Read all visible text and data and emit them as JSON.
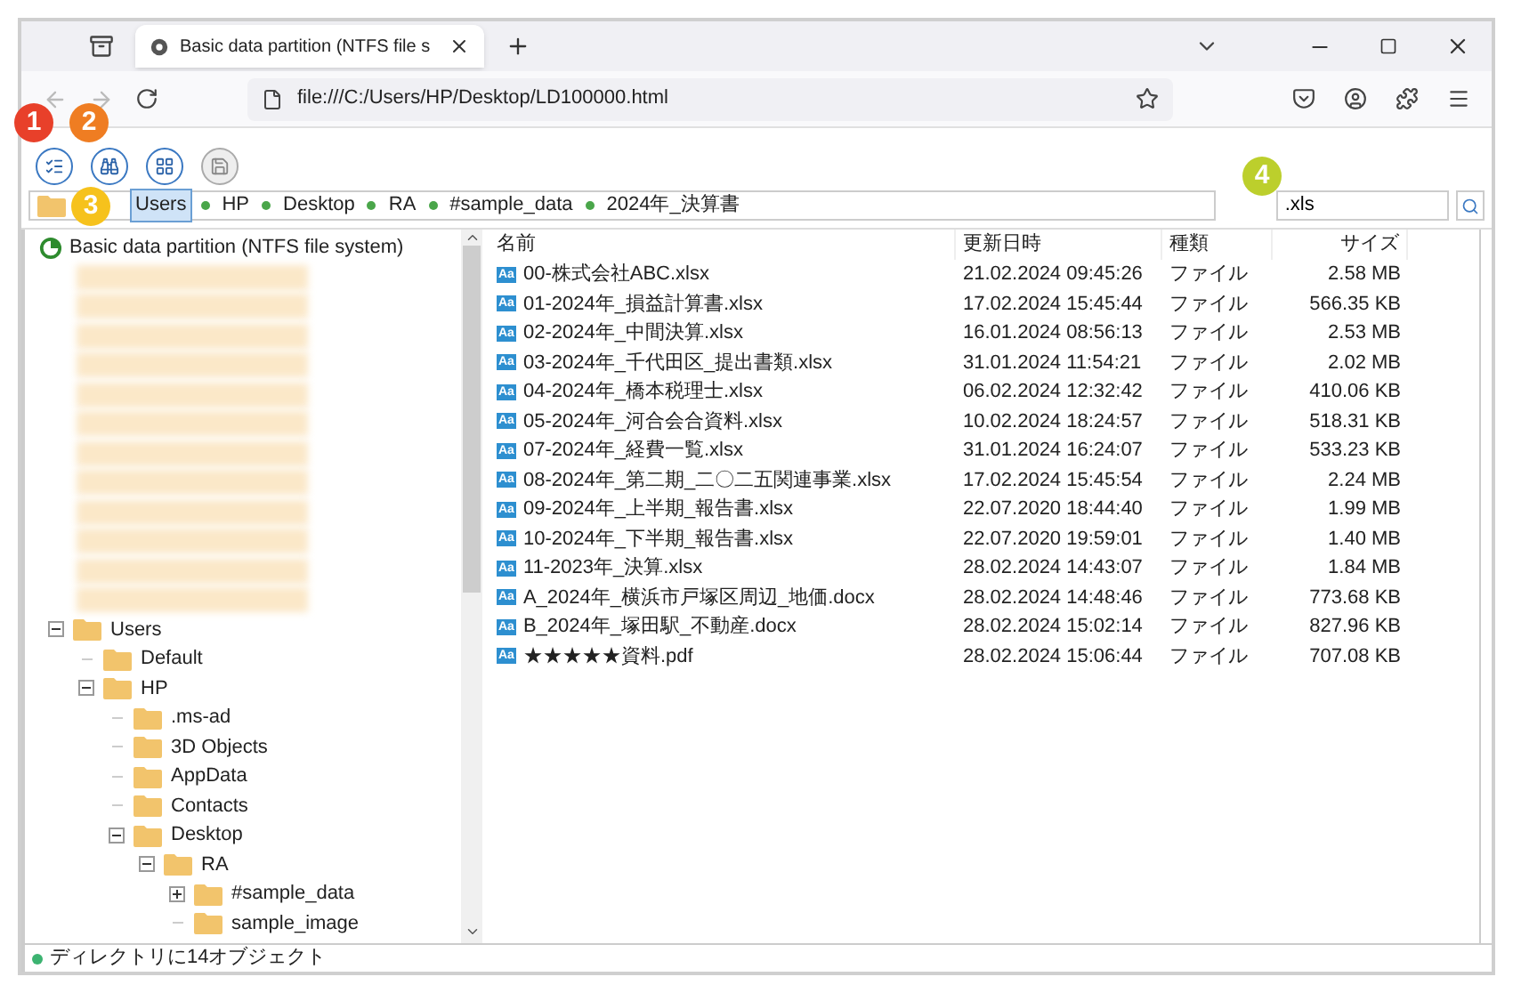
{
  "browser": {
    "tab_title": "Basic data partition (NTFS file s",
    "url": "file:///C:/Users/HP/Desktop/LD100000.html"
  },
  "toolbar": {
    "buttons": [
      {
        "kind": "list",
        "disabled": false
      },
      {
        "kind": "binoculars",
        "disabled": false
      },
      {
        "kind": "window",
        "disabled": false
      },
      {
        "kind": "save",
        "disabled": true
      }
    ]
  },
  "breadcrumb": [
    {
      "label": "Users",
      "selected": true
    },
    {
      "label": "HP",
      "selected": false
    },
    {
      "label": "Desktop",
      "selected": false
    },
    {
      "label": "RA",
      "selected": false
    },
    {
      "label": "#sample_data",
      "selected": false
    },
    {
      "label": "2024年_決算書",
      "selected": false
    }
  ],
  "search": {
    "value": ".xls"
  },
  "tree": {
    "label": "Basic data partition (NTFS file system)",
    "children": [
      {
        "kind": "redacted"
      },
      {
        "kind": "redacted"
      },
      {
        "kind": "redacted"
      },
      {
        "kind": "redacted"
      },
      {
        "kind": "redacted"
      },
      {
        "kind": "redacted"
      },
      {
        "kind": "redacted"
      },
      {
        "kind": "redacted"
      },
      {
        "kind": "redacted"
      },
      {
        "kind": "redacted"
      },
      {
        "kind": "redacted"
      },
      {
        "kind": "redacted"
      },
      {
        "kind": "folder",
        "label": "Users",
        "expanded": true,
        "children": [
          {
            "kind": "folder",
            "label": "Default"
          },
          {
            "kind": "folder",
            "label": "HP",
            "expanded": true,
            "children": [
              {
                "kind": "folder",
                "label": ".ms-ad"
              },
              {
                "kind": "folder",
                "label": "3D Objects"
              },
              {
                "kind": "folder",
                "label": "AppData"
              },
              {
                "kind": "folder",
                "label": "Contacts"
              },
              {
                "kind": "folder",
                "label": "Desktop",
                "expanded": true,
                "children": [
                  {
                    "kind": "folder",
                    "label": "RA",
                    "expanded": true,
                    "children": [
                      {
                        "kind": "folder",
                        "label": "#sample_data",
                        "expanded": false
                      },
                      {
                        "kind": "folder",
                        "label": "sample_image"
                      }
                    ]
                  }
                ]
              }
            ]
          }
        ]
      }
    ]
  },
  "table": {
    "columns": [
      "名前",
      "更新日時",
      "種類",
      "サイズ"
    ],
    "rows": [
      {
        "badge": "Aa",
        "name": "00-株式会社ABC.xlsx",
        "modified": "21.02.2024 09:45:26",
        "type": "ファイル",
        "size": "2.58 MB"
      },
      {
        "badge": "Aa",
        "name": "01-2024年_損益計算書.xlsx",
        "modified": "17.02.2024 15:45:44",
        "type": "ファイル",
        "size": "566.35 KB"
      },
      {
        "badge": "Aa",
        "name": "02-2024年_中間決算.xlsx",
        "modified": "16.01.2024 08:56:13",
        "type": "ファイル",
        "size": "2.53 MB"
      },
      {
        "badge": "Aa",
        "name": "03-2024年_千代田区_提出書類.xlsx",
        "modified": "31.01.2024 11:54:21",
        "type": "ファイル",
        "size": "2.02 MB"
      },
      {
        "badge": "Aa",
        "name": "04-2024年_橋本税理士.xlsx",
        "modified": "06.02.2024 12:32:42",
        "type": "ファイル",
        "size": "410.06 KB"
      },
      {
        "badge": "Aa",
        "name": "05-2024年_河合会合資料.xlsx",
        "modified": "10.02.2024 18:24:57",
        "type": "ファイル",
        "size": "518.31 KB"
      },
      {
        "badge": "Aa",
        "name": "07-2024年_経費一覧.xlsx",
        "modified": "31.01.2024 16:24:07",
        "type": "ファイル",
        "size": "533.23 KB"
      },
      {
        "badge": "Aa",
        "name": "08-2024年_第二期_二〇二五関連事業.xlsx",
        "modified": "17.02.2024 15:45:54",
        "type": "ファイル",
        "size": "2.24 MB"
      },
      {
        "badge": "Aa",
        "name": "09-2024年_上半期_報告書.xlsx",
        "modified": "22.07.2020 18:44:40",
        "type": "ファイル",
        "size": "1.99 MB"
      },
      {
        "badge": "Aa",
        "name": "10-2024年_下半期_報告書.xlsx",
        "modified": "22.07.2020 19:59:01",
        "type": "ファイル",
        "size": "1.40 MB"
      },
      {
        "badge": "Aa",
        "name": "11-2023年_決算.xlsx",
        "modified": "28.02.2024 14:43:07",
        "type": "ファイル",
        "size": "1.84 MB"
      },
      {
        "badge": "Aa",
        "name": "A_2024年_横浜市戸塚区周辺_地価.docx",
        "modified": "28.02.2024 14:48:46",
        "type": "ファイル",
        "size": "773.68 KB"
      },
      {
        "badge": "Aa",
        "name": "B_2024年_塚田駅_不動産.docx",
        "modified": "28.02.2024 15:02:14",
        "type": "ファイル",
        "size": "827.96 KB"
      },
      {
        "badge": "Aa",
        "name": "★★★★★資料.pdf",
        "modified": "28.02.2024 15:06:44",
        "type": "ファイル",
        "size": "707.08 KB"
      }
    ]
  },
  "status_bar": {
    "text": "ディレクトリに14オブジェクト",
    "color": "#3cb371"
  },
  "callouts": [
    {
      "label": "1",
      "color": "#e8402a"
    },
    {
      "label": "2",
      "color": "#ef7d22"
    },
    {
      "label": "3",
      "color": "#f6c21c"
    },
    {
      "label": "4",
      "color": "#bccf2c"
    }
  ]
}
